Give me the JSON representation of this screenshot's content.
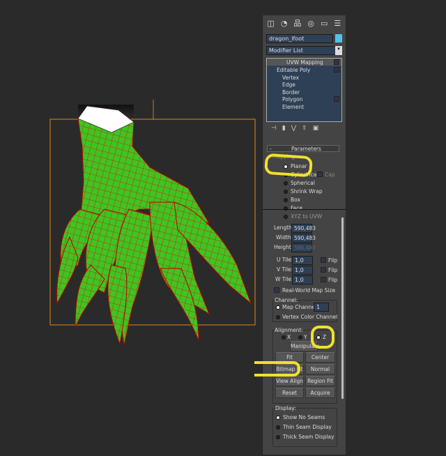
{
  "object_name": "dragon_lfoot",
  "object_color": "#4fc3e8",
  "modifier_list": "Modifier List",
  "stack": [
    {
      "label": "UVW Mapping",
      "level": 0
    },
    {
      "label": "Editable Poly",
      "level": 0
    },
    {
      "label": "Vertex",
      "level": 1
    },
    {
      "label": "Edge",
      "level": 1
    },
    {
      "label": "Border",
      "level": 1
    },
    {
      "label": "Polygon",
      "level": 1
    },
    {
      "label": "Element",
      "level": 1
    }
  ],
  "rollout_title": "Parameters",
  "mapping": {
    "label": "Mapping:",
    "options": [
      "Planar",
      "Cylindrical",
      "Spherical",
      "Shrink Wrap",
      "Box",
      "Face",
      "XYZ to UVW"
    ],
    "selected": "Planar",
    "cap": "Cap"
  },
  "dims": {
    "length_label": "Length:",
    "length": "590,483",
    "width_label": "Width:",
    "width": "590,483",
    "height_label": "Height:",
    "height": "590,483"
  },
  "tiles": {
    "u_label": "U Tile:",
    "u": "1,0",
    "v_label": "V Tile:",
    "v": "1,0",
    "w_label": "W Tile:",
    "w": "1,0",
    "flip": "Flip"
  },
  "real_world": "Real-World Map Size",
  "channel": {
    "label": "Channel:",
    "map_channel": "Map Channel:",
    "map_channel_value": "1",
    "vertex_color": "Vertex Color Channel"
  },
  "alignment": {
    "label": "Alignment:",
    "x": "X",
    "y": "Y",
    "z": "Z",
    "selected": "Z",
    "manipulate": "Manipulate",
    "fit": "Fit",
    "center": "Center",
    "bitmap_fit": "Bitmap Fit",
    "normal_align": "Normal Align",
    "view_align": "View Align",
    "region_fit": "Region Fit",
    "reset": "Reset",
    "acquire": "Acquire"
  },
  "display": {
    "label": "Display:",
    "options": [
      "Show No Seams",
      "Thin Seam Display",
      "Thick Seam Display"
    ],
    "selected": "Show No Seams"
  },
  "colors": {
    "mesh": "#3fc421",
    "wire": "#e01010",
    "gizmo": "#e08a1a",
    "highlight": "#f2e02a"
  }
}
